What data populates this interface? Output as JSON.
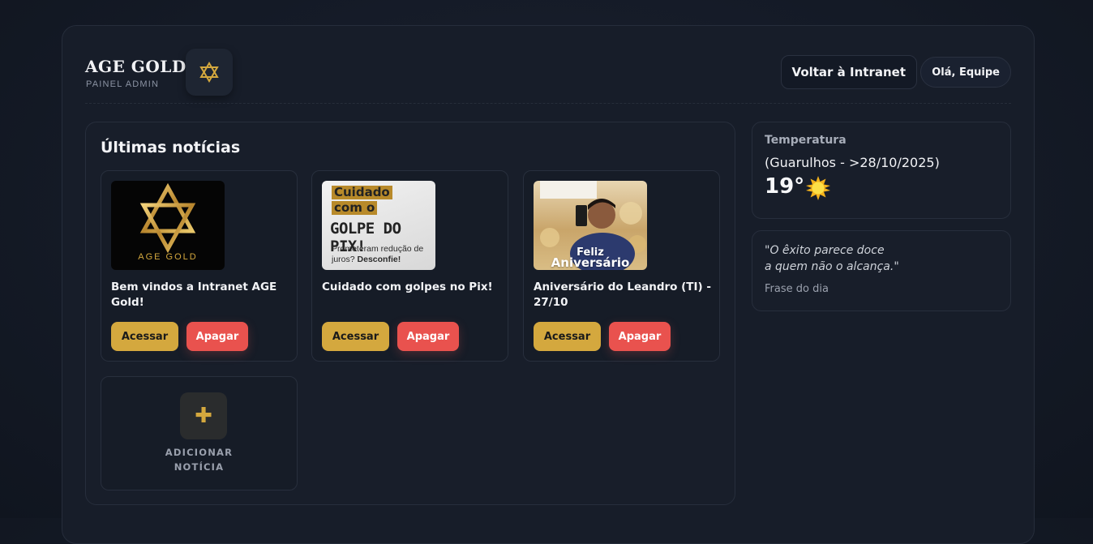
{
  "header": {
    "brand_title": "AGE GOLD",
    "brand_subtitle": "PAINEL ADMIN",
    "back_button": "Voltar à Intranet",
    "user_greeting": "Olá, Equipe"
  },
  "news": {
    "title": "Últimas notícias",
    "access_label": "Acessar",
    "delete_label": "Apagar",
    "items": [
      {
        "title": "Bem vindos a Intranet AGE Gold!",
        "thumb_caption": "AGE GOLD"
      },
      {
        "title": "Cuidado com golpes no Pix!",
        "thumb_line1": "Cuidado",
        "thumb_line2": "com o",
        "thumb_big": "GOLPE DO PIX!",
        "thumb_small_a": "Prometeram redução de juros?",
        "thumb_small_b": "Desconfie!"
      },
      {
        "title": "Aniversário do Leandro (TI) - 27/10",
        "thumb_line1": "Feliz",
        "thumb_line2": "Aniversário"
      }
    ],
    "add_label_line1": "ADICIONAR",
    "add_label_line2": "NOTÍCIA"
  },
  "weather": {
    "label": "Temperatura",
    "location": "(Guarulhos - >28/10/2025)",
    "temperature": "19°",
    "icon": "sun-icon"
  },
  "quote": {
    "line1": "\"O êxito parece doce",
    "line2": "a quem não o alcança.\"",
    "caption": "Frase do dia"
  },
  "colors": {
    "accent_gold": "#d4a83e",
    "danger": "#e9524e",
    "background": "#141a26"
  }
}
